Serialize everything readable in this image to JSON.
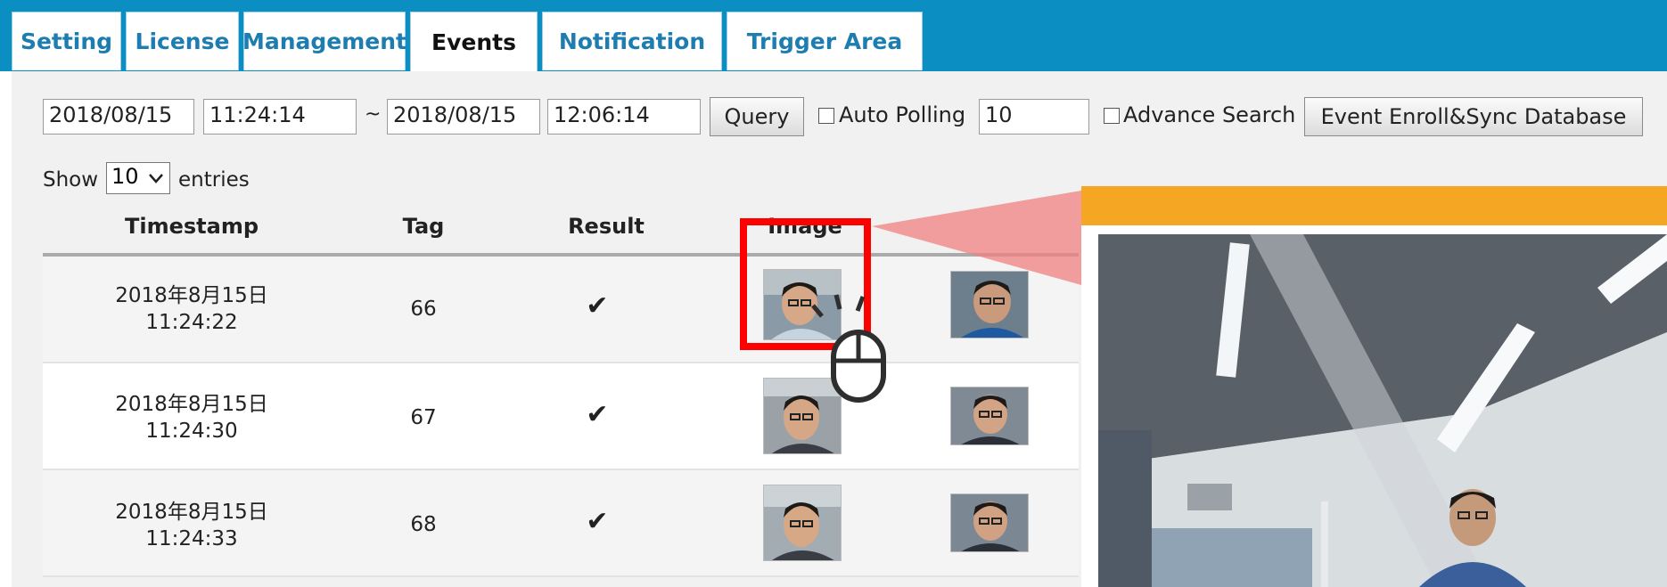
{
  "tabs": [
    {
      "label": "Setting",
      "active": false
    },
    {
      "label": "License",
      "active": false
    },
    {
      "label": "Management",
      "active": false
    },
    {
      "label": "Events",
      "active": true
    },
    {
      "label": "Notification",
      "active": false
    },
    {
      "label": "Trigger Area",
      "active": false
    }
  ],
  "query": {
    "start_date": "2018/08/15",
    "start_time": "11:24:14",
    "separator": "~",
    "end_date": "2018/08/15",
    "end_time": "12:06:14",
    "query_label": "Query",
    "auto_polling_label": "Auto Polling",
    "auto_polling_checked": false,
    "polling_interval": "10",
    "advance_search_label": "Advance Search",
    "advance_search_checked": false,
    "enroll_sync_label": "Event Enroll&Sync Database"
  },
  "entries": {
    "show_label": "Show",
    "page_size": "10",
    "entries_label": "entries"
  },
  "table": {
    "columns": [
      "Timestamp",
      "Tag",
      "Result",
      "Image"
    ],
    "rows": [
      {
        "date": "2018年8月15日",
        "time": "11:24:22",
        "tag": "66",
        "result": "✔"
      },
      {
        "date": "2018年8月15日",
        "time": "11:24:30",
        "tag": "67",
        "result": "✔"
      },
      {
        "date": "2018年8月15日",
        "time": "11:24:33",
        "tag": "68",
        "result": "✔"
      }
    ]
  },
  "colors": {
    "header_bar": "#0b8fc2",
    "tab_text": "#1e7db0",
    "highlight_box": "#ff0000",
    "popup_bar": "#f5a623",
    "callout": "#f08080"
  },
  "icons": {
    "result": "check-icon",
    "cursor": "mouse-click-icon",
    "dropdown": "chevron-down-icon"
  }
}
